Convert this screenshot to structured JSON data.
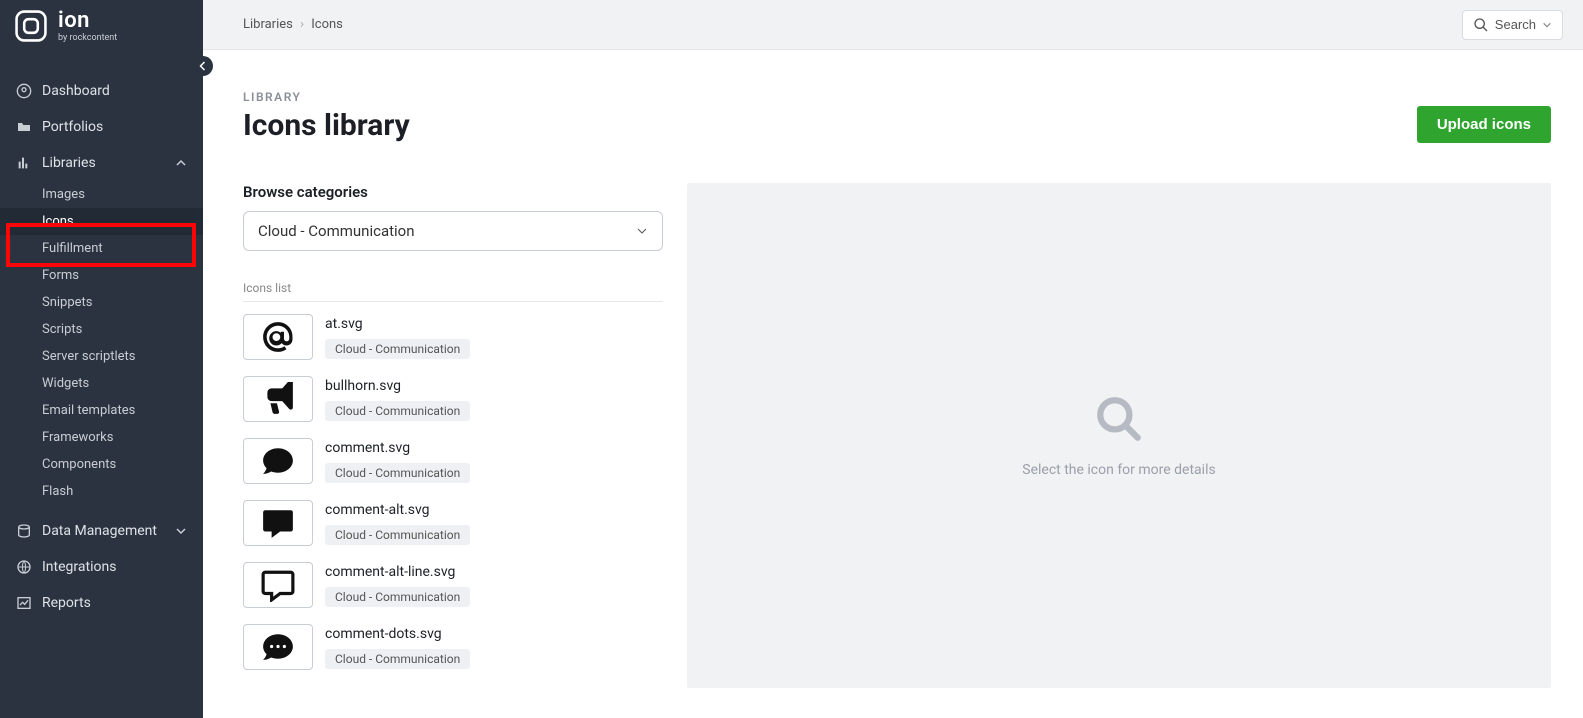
{
  "brand": {
    "word": "ion",
    "by": "by rockcontent"
  },
  "breadcrumb": {
    "a": "Libraries",
    "b": "Icons"
  },
  "search": {
    "label": "Search"
  },
  "page": {
    "eyebrow": "LIBRARY",
    "title": "Icons library",
    "upload": "Upload icons",
    "browse_label": "Browse categories",
    "category_selected": "Cloud - Communication",
    "list_label": "Icons list",
    "empty_hint": "Select the icon for more details"
  },
  "sidebar": {
    "dashboard": "Dashboard",
    "portfolios": "Portfolios",
    "libraries": "Libraries",
    "data_management": "Data Management",
    "integrations": "Integrations",
    "reports": "Reports",
    "sub": {
      "images": "Images",
      "icons": "Icons",
      "fulfillment": "Fulfillment",
      "forms": "Forms",
      "snippets": "Snippets",
      "scripts": "Scripts",
      "server_scriptlets": "Server scriptlets",
      "widgets": "Widgets",
      "email_templates": "Email templates",
      "frameworks": "Frameworks",
      "components": "Components",
      "flash": "Flash"
    }
  },
  "icons": [
    {
      "file": "at.svg",
      "category": "Cloud - Communication"
    },
    {
      "file": "bullhorn.svg",
      "category": "Cloud - Communication"
    },
    {
      "file": "comment.svg",
      "category": "Cloud - Communication"
    },
    {
      "file": "comment-alt.svg",
      "category": "Cloud - Communication"
    },
    {
      "file": "comment-alt-line.svg",
      "category": "Cloud - Communication"
    },
    {
      "file": "comment-dots.svg",
      "category": "Cloud - Communication"
    }
  ]
}
